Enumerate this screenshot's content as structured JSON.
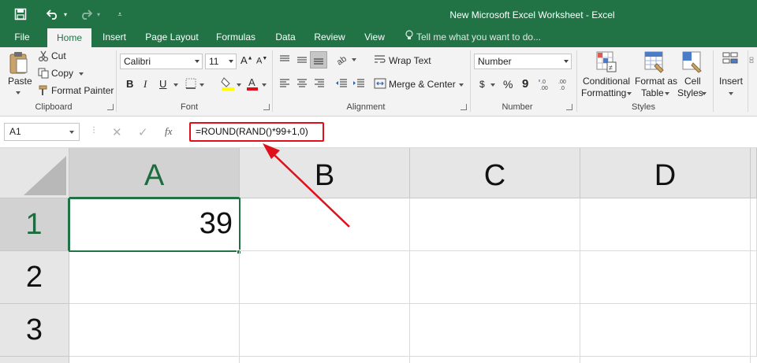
{
  "window": {
    "title": "New Microsoft Excel Worksheet - Excel"
  },
  "tabs": [
    "File",
    "Home",
    "Insert",
    "Page Layout",
    "Formulas",
    "Data",
    "Review",
    "View"
  ],
  "active_tab": "Home",
  "tell_me": "Tell me what you want to do...",
  "ribbon": {
    "clipboard": {
      "label": "Clipboard",
      "paste": "Paste",
      "cut": "Cut",
      "copy": "Copy",
      "format_painter": "Format Painter"
    },
    "font": {
      "label": "Font",
      "font_name": "Calibri",
      "font_size": "11"
    },
    "alignment": {
      "label": "Alignment",
      "wrap_text": "Wrap Text",
      "merge_center": "Merge & Center"
    },
    "number": {
      "label": "Number",
      "format": "Number",
      "currency": "$",
      "percent": "%",
      "comma": "9"
    },
    "styles": {
      "label": "Styles",
      "conditional_1": "Conditional",
      "conditional_2": "Formatting",
      "format_table_1": "Format as",
      "format_table_2": "Table",
      "cell_styles_1": "Cell",
      "cell_styles_2": "Styles"
    },
    "cells": {
      "insert": "Insert"
    }
  },
  "formula_bar": {
    "name_box": "A1",
    "fx": "fx",
    "formula": "=ROUND(RAND()*99+1,0)"
  },
  "grid": {
    "columns": [
      "A",
      "B",
      "C",
      "D"
    ],
    "rows": [
      "1",
      "2",
      "3"
    ],
    "active_cell_value": "39"
  },
  "colors": {
    "accent": "#217346",
    "highlight": "#e0101a"
  }
}
